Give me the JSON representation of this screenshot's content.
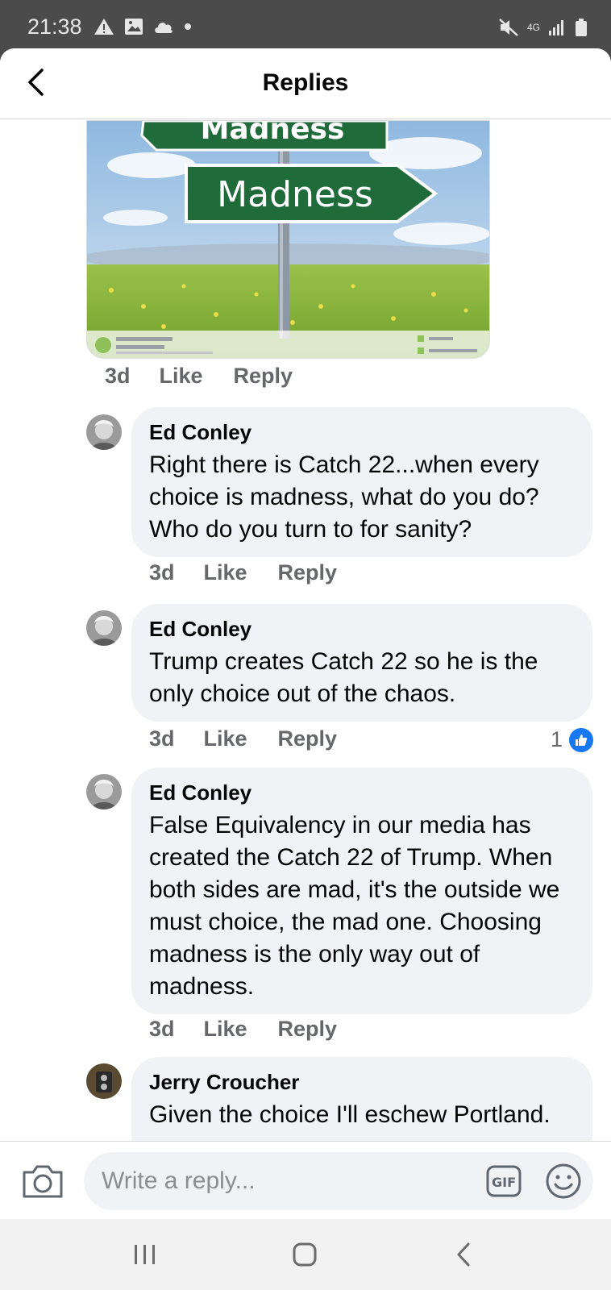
{
  "status_bar": {
    "time": "21:38",
    "network": "4G",
    "left_icons": [
      "warning-icon",
      "image-icon",
      "cloud-icon",
      "dot-icon"
    ],
    "right_icons": [
      "mute-icon",
      "network-4g-icon",
      "signal-icon",
      "battery-icon"
    ]
  },
  "header": {
    "title": "Replies"
  },
  "attachment": {
    "sign_top": "Madness",
    "sign_main": "Madness",
    "actions": {
      "time": "3d",
      "like": "Like",
      "reply": "Reply"
    }
  },
  "comments": [
    {
      "author": "Ed Conley",
      "text": "Right there is Catch 22...when every choice is madness, what do you do? Who do you turn to for sanity?",
      "actions": {
        "time": "3d",
        "like": "Like",
        "reply": "Reply"
      }
    },
    {
      "author": "Ed Conley",
      "text": "Trump creates Catch 22 so he is the only choice out of the chaos.",
      "actions": {
        "time": "3d",
        "like": "Like",
        "reply": "Reply"
      },
      "reaction_count": "1"
    },
    {
      "author": "Ed Conley",
      "text": "False Equivalency in our media has created the Catch 22 of Trump. When both sides are mad, it's the outside we must choice, the mad one. Choosing madness is the only way out of madness.",
      "actions": {
        "time": "3d",
        "like": "Like",
        "reply": "Reply"
      }
    },
    {
      "author": "Jerry Croucher",
      "text": "Given the choice I'll eschew Portland."
    }
  ],
  "composer": {
    "placeholder": "Write a reply...",
    "gif_label": "GIF"
  },
  "colors": {
    "accent": "#1877f2",
    "bubble": "#f0f2f5",
    "meta_text": "#65676b",
    "sign_green": "#1f6b3a"
  }
}
